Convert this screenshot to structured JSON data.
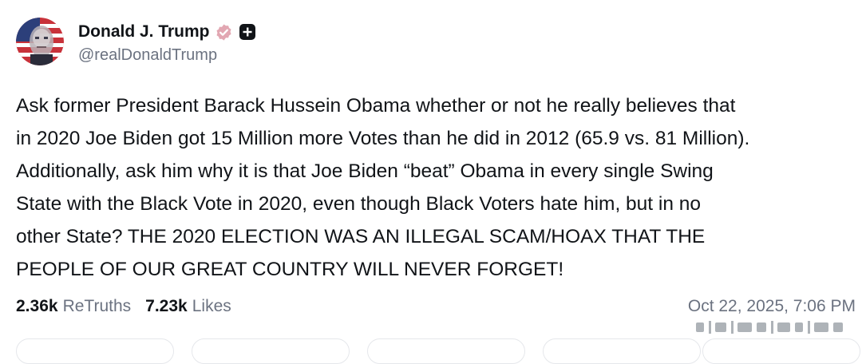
{
  "author": {
    "display_name": "Donald J. Trump",
    "handle": "@realDonaldTrump",
    "avatar_icon": "portrait-avatar-icon",
    "verified_icon": "verified-badge-icon",
    "follow_icon": "plus-follow-icon"
  },
  "post": {
    "text": "Ask former President Barack Hussein Obama whether or not he really believes that\nin 2020 Joe Biden got 15 Million more Votes than he did in 2012 (65.9 vs. 81 Million).\nAdditionally, ask him why it is that Joe Biden “beat” Obama in every single Swing\nState with the Black Vote in 2020, even though Black Voters hate him, but in no\nother State? THE 2020 ELECTION WAS AN ILLEGAL SCAM/HOAX THAT THE\nPEOPLE OF OUR GREAT COUNTRY WILL NEVER FORGET!"
  },
  "stats": {
    "retruths_count": "2.36k",
    "retruths_label": "ReTruths",
    "likes_count": "7.23k",
    "likes_label": "Likes"
  },
  "timestamp": "Oct 22, 2025, 7:06 PM",
  "colors": {
    "text": "#111418",
    "muted": "#6b7280",
    "verified_badge": "#e2a7b2",
    "follow_badge": "#111418",
    "divider": "#e5e7eb"
  }
}
